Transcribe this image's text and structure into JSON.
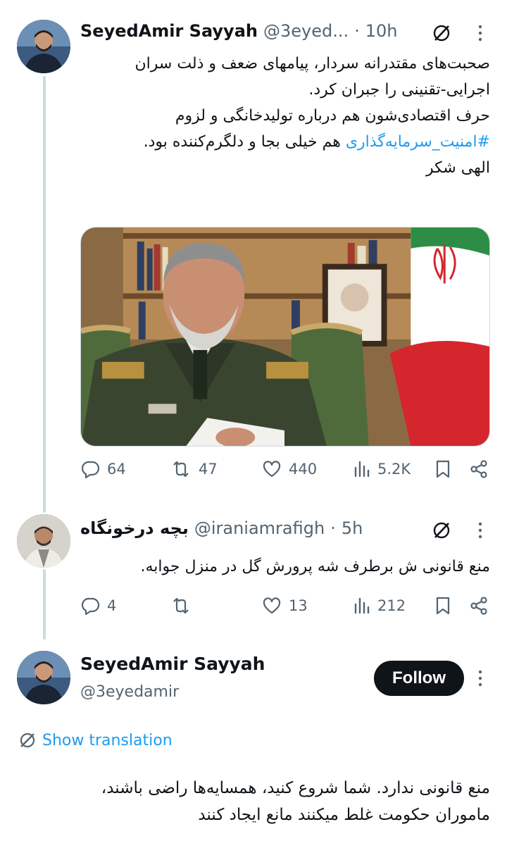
{
  "main_tweet": {
    "author_name": "SeyedAmir Sayyah",
    "handle": "@3eyed...",
    "separator": "·",
    "time": "10h",
    "text_lines": [
      "صحبت‌های مقتدرانه سردار، پیامهای ضعف و ذلت سران",
      "اجرایی-تقنینی را جبران کرد.",
      "حرف اقتصادی‌شون هم درباره تولیدخانگی و لزوم"
    ],
    "line4_hashtag": "#امنیت_سرمایه‌گذاری",
    "line4_rest": " هم خیلی بجا و دلگرم‌کننده بود.",
    "text_line5": "الهی شکر",
    "stats": {
      "replies": "64",
      "reposts": "47",
      "likes": "440",
      "views": "5.2K"
    }
  },
  "reply_tweet": {
    "author_name": "بچه درخونگاه",
    "handle": "@iraniamrafigh",
    "separator": "·",
    "time": "5h",
    "text": "منع قانونی ش برطرف شه پرورش گل در منزل جوابه.",
    "stats": {
      "replies": "4",
      "reposts": "",
      "likes": "13",
      "views": "212"
    }
  },
  "focus_tweet": {
    "author_name": "SeyedAmir Sayyah",
    "handle": "@3eyedamir",
    "follow_label": "Follow",
    "show_translation": "Show translation",
    "text_lines": [
      "منع قانونی ندارد. شما شروع کنید، همسایه‌ها راضی باشند،",
      "ماموران حکومت غلط میکنند مانع ایجاد کنند"
    ]
  },
  "colors": {
    "accent": "#1d9bf0",
    "muted": "#536471",
    "text": "#0f1419"
  },
  "icons": [
    "grok-icon",
    "more-icon",
    "reply-icon",
    "repost-icon",
    "like-icon",
    "views-icon",
    "bookmark-icon",
    "share-icon",
    "translate-icon"
  ]
}
